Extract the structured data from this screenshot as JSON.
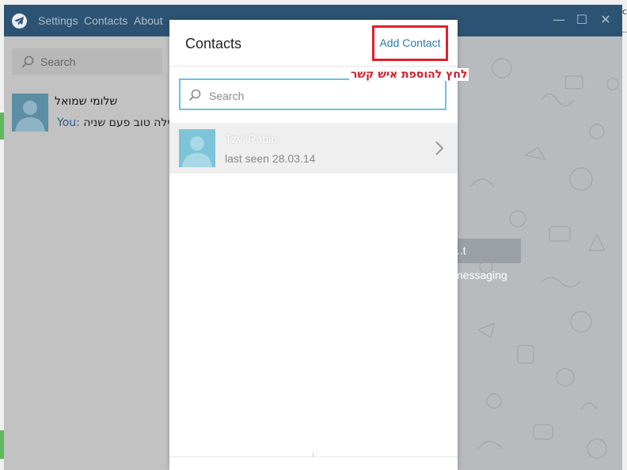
{
  "titlebar": {
    "menu": [
      "Settings",
      "Contacts",
      "About"
    ],
    "minimize": "—",
    "maximize": "☐",
    "close": "✕"
  },
  "sidebar": {
    "search_placeholder": "Search",
    "chats": [
      {
        "name": "שלומי שמואל",
        "sender": "You:",
        "preview": "לילה טוב פעם שניה"
      }
    ]
  },
  "chat_area": {
    "start_messaging": "...t messaging"
  },
  "contacts_modal": {
    "title": "Contacts",
    "add_contact_label": "Add Contact",
    "annotation": "לחץ להוספת איש קשר",
    "search_placeholder": "Search",
    "contacts": [
      {
        "name": "Tzvi Rabin",
        "last_seen": "last seen 28.03.14"
      }
    ]
  },
  "outer": {
    "right_text": "c"
  },
  "colors": {
    "titlebar": "#2c5373",
    "accent": "#2a7ab0",
    "highlight_red": "#e0202a",
    "search_border": "#6ec0e6"
  }
}
